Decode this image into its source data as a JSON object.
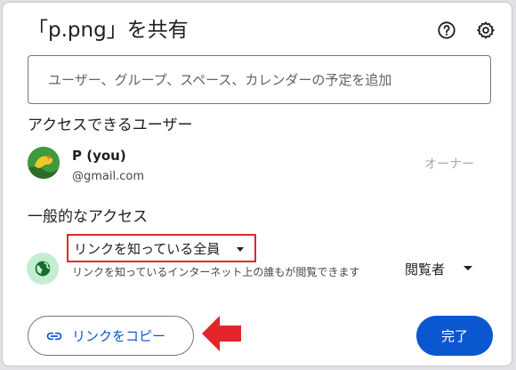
{
  "dialog": {
    "title": "「p.png」を共有",
    "help_icon": "help-circle-icon",
    "settings_icon": "gear-icon"
  },
  "add_people": {
    "placeholder": "ユーザー、グループ、スペース、カレンダーの予定を追加"
  },
  "people_with_access": {
    "heading": "アクセスできるユーザー",
    "users": [
      {
        "name": "P (you)",
        "email": "@gmail.com",
        "role": "オーナー"
      }
    ]
  },
  "general_access": {
    "heading": "一般的なアクセス",
    "selected_option": "リンクを知っている全員",
    "description": "リンクを知っているインターネット上の誰もが閲覧できます",
    "role": "閲覧者",
    "icon": "globe-icon"
  },
  "footer": {
    "copy_link_label": "リンクをコピー",
    "copy_link_icon": "link-icon",
    "done_label": "完了"
  },
  "colors": {
    "primary": "#0b57d0",
    "highlight_border": "#e3262b",
    "annotation_arrow": "#e3262b",
    "globe_bg": "#c4eed0"
  }
}
